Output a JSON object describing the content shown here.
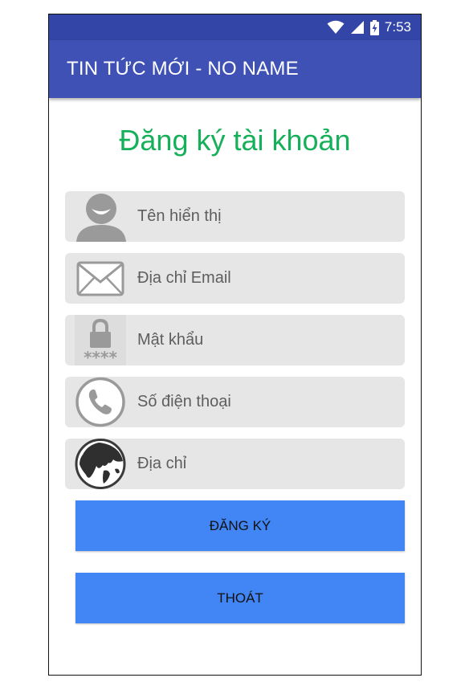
{
  "status_bar": {
    "time": "7:53",
    "icons": [
      "wifi-icon",
      "cellular-signal-icon",
      "battery-charging-icon"
    ]
  },
  "app_bar": {
    "title": "TIN TỨC MỚI - NO NAME"
  },
  "form": {
    "title": "Đăng ký tài khoản",
    "fields": [
      {
        "placeholder": "Tên hiển thị",
        "icon": "user-avatar-icon"
      },
      {
        "placeholder": "Địa chỉ Email",
        "icon": "envelope-icon"
      },
      {
        "placeholder": "Mật khẩu",
        "icon": "lock-password-icon"
      },
      {
        "placeholder": "Số điện thoại",
        "icon": "phone-icon"
      },
      {
        "placeholder": "Địa chỉ",
        "icon": "globe-icon"
      }
    ],
    "register_button": "ĐĂNG KÝ",
    "exit_button": "THOÁT"
  },
  "colors": {
    "status_bar": "#3346a8",
    "app_bar": "#3f51b5",
    "title_green": "#16b05a",
    "field_bg": "#e6e6e7",
    "button_blue": "#4286f5"
  }
}
